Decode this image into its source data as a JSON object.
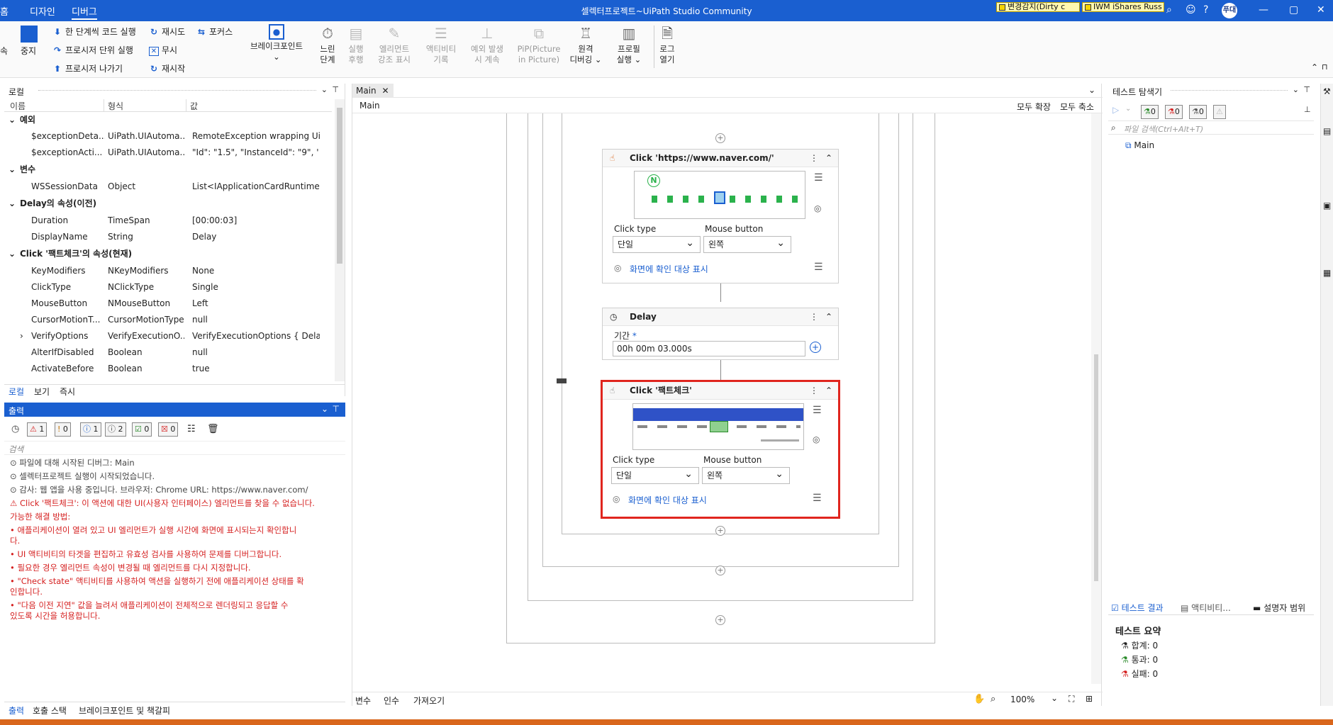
{
  "titlebar": {
    "left_stub": "홈",
    "tabs": [
      "디자인",
      "디버그"
    ],
    "title": "셀렉터프로젝트~UiPath Studio Community",
    "badge1": "변경감지(Dirty c",
    "badge2": "IWM iShares Russ",
    "avatar": "푸대",
    "colors": {
      "bar": "#1a5fd0",
      "error": "#d52020",
      "highlight": "#e0251e"
    }
  },
  "ribbon": {
    "stop_label": "중지",
    "left_stub": "속",
    "step_into": "한 단계씩 코드 실행",
    "step_over": "프로시저 단위 실행",
    "step_out": "프로시저 나가기",
    "retry": "재시도",
    "ignore": "무시",
    "restart": "재시작",
    "focus": "포커스",
    "breakpoint": "브레이크포인트",
    "slow_step": [
      "느린",
      "단계"
    ],
    "exec_trail": [
      "실행",
      "후행"
    ],
    "highlight": [
      "엘리먼트",
      "강조 표시"
    ],
    "log_activities": [
      "액티비티",
      "기록"
    ],
    "continue_on_exception": [
      "예외 발생",
      "시 계속"
    ],
    "pip": [
      "PiP(Picture",
      "in Picture)"
    ],
    "remote_debug": [
      "원격",
      "디버깅"
    ],
    "profile": [
      "프로필",
      "실행"
    ],
    "open_logs": [
      "로그",
      "열기"
    ]
  },
  "locals": {
    "title": "로컬",
    "columns": [
      "이름",
      "형식",
      "값"
    ],
    "groups": {
      "exception": "예외",
      "variables": "변수",
      "delay_props": "Delay의 속성(이전)",
      "click_props": "Click '팩트체크'의 속성(현재)"
    },
    "exception_rows": [
      {
        "name": "$exceptionDeta...",
        "type": "UiPath.UIAutoma...",
        "value": "RemoteException wrapping UiPa"
      },
      {
        "name": "$exceptionActi...",
        "type": "UiPath.UIAutoma...",
        "value": "\"Id\": \"1.5\",  \"InstanceId\": \"9\",  '"
      }
    ],
    "variable_rows": [
      {
        "name": "WSSessionData",
        "type": "Object",
        "value": "List<IApplicationCardRuntime..."
      }
    ],
    "delay_rows": [
      {
        "name": "Duration",
        "type": "TimeSpan",
        "value": "[00:00:03]"
      },
      {
        "name": "DisplayName",
        "type": "String",
        "value": "Delay"
      }
    ],
    "click_rows": [
      {
        "name": "KeyModifiers",
        "type": "NKeyModifiers",
        "value": "None"
      },
      {
        "name": "ClickType",
        "type": "NClickType",
        "value": "Single"
      },
      {
        "name": "MouseButton",
        "type": "NMouseButton",
        "value": "Left"
      },
      {
        "name": "CursorMotionT...",
        "type": "CursorMotionType",
        "value": "null"
      },
      {
        "name": "VerifyOptions",
        "type": "VerifyExecutionO...",
        "value": "VerifyExecutionOptions { Dela..."
      },
      {
        "name": "AlterIfDisabled",
        "type": "Boolean",
        "value": "null"
      },
      {
        "name": "ActivateBefore",
        "type": "Boolean",
        "value": "true"
      }
    ],
    "bottom_tabs": [
      "로컬",
      "보기",
      "즉시"
    ]
  },
  "output": {
    "title": "출력",
    "filters": [
      "1",
      "0",
      "1",
      "2",
      "0",
      "0"
    ],
    "search_placeholder": "검색",
    "logs": [
      {
        "kind": "info",
        "text": "⊙ 파일에 대해 시작된 디버그: Main"
      },
      {
        "kind": "info",
        "text": "⊙ 셀렉터프로젝트 실행이 시작되었습니다."
      },
      {
        "kind": "info",
        "text": "⊙ 감사: 웹 앱을 사용 중입니다. 브라우저: Chrome URL: https://www.naver.com/"
      },
      {
        "kind": "err",
        "text": "⚠ Click '팩트체크': 이 액션에 대한 UI(사용자 인터페이스) 엘리먼트를 찾을 수 없습니다."
      },
      {
        "kind": "err",
        "text": "   가능한 해결 방법:"
      },
      {
        "kind": "err",
        "text": "   • 애플리케이션이 열려 있고 UI 엘리먼트가 실행 시간에 화면에 표시되는지 확인합니"
      },
      {
        "kind": "err",
        "text": "   다."
      },
      {
        "kind": "err",
        "text": "   • UI 액티비티의 타겟을 편집하고 유효성 검사를 사용하여 문제를 디버그합니다."
      },
      {
        "kind": "err",
        "text": "   • 필요한 경우 엘리먼트 속성이 변경될 때 엘리먼트를 다시 지정합니다."
      },
      {
        "kind": "err",
        "text": "   • \"Check state\" 액티비티를 사용하여 액션을 실행하기 전에 애플리케이션 상태를 확"
      },
      {
        "kind": "err",
        "text": "   인합니다."
      },
      {
        "kind": "err",
        "text": "   • \"다음 이전 지연\" 값을 늘려서 애플리케이션이 전체적으로 렌더링되고 응답할 수"
      },
      {
        "kind": "err",
        "text": "   있도록 시간을 허용합니다."
      }
    ],
    "bottom_tabs": [
      "출력",
      "호출 스택",
      "브레이크포인트 및 책갈피"
    ]
  },
  "designer": {
    "tab": "Main",
    "breadcrumb": "Main",
    "expand_all": "모두 확장",
    "collapse_all": "모두 축소",
    "click1": {
      "title": "Click 'https://www.naver.com/'",
      "click_type_label": "Click type",
      "mouse_button_label": "Mouse button",
      "click_type": "단일",
      "mouse_button": "왼쪽",
      "show_target": "화면에 확인 대상 표시",
      "preview_logo": "N"
    },
    "delay": {
      "title": "Delay",
      "duration_label": "기간",
      "duration": "00h 00m 03.000s"
    },
    "click2": {
      "title": "Click '팩트체크'",
      "click_type_label": "Click type",
      "mouse_button_label": "Mouse button",
      "click_type": "단일",
      "mouse_button": "왼쪽",
      "show_target": "화면에 확인 대상 표시"
    },
    "footer_tabs": [
      "변수",
      "인수",
      "가져오기"
    ],
    "zoom": "100%"
  },
  "testpanel": {
    "title": "테스트 탐색기",
    "counts": [
      "0",
      "0",
      "0"
    ],
    "search_placeholder": "파일 검색(Ctrl+Alt+T)",
    "tree_item": "Main",
    "bottom_tabs": [
      "테스트 결과",
      "액티비티...",
      "설명자 범위"
    ],
    "summary_title": "테스트 요약",
    "total": "합계: 0",
    "passed": "통과: 0",
    "failed": "실패: 0"
  }
}
